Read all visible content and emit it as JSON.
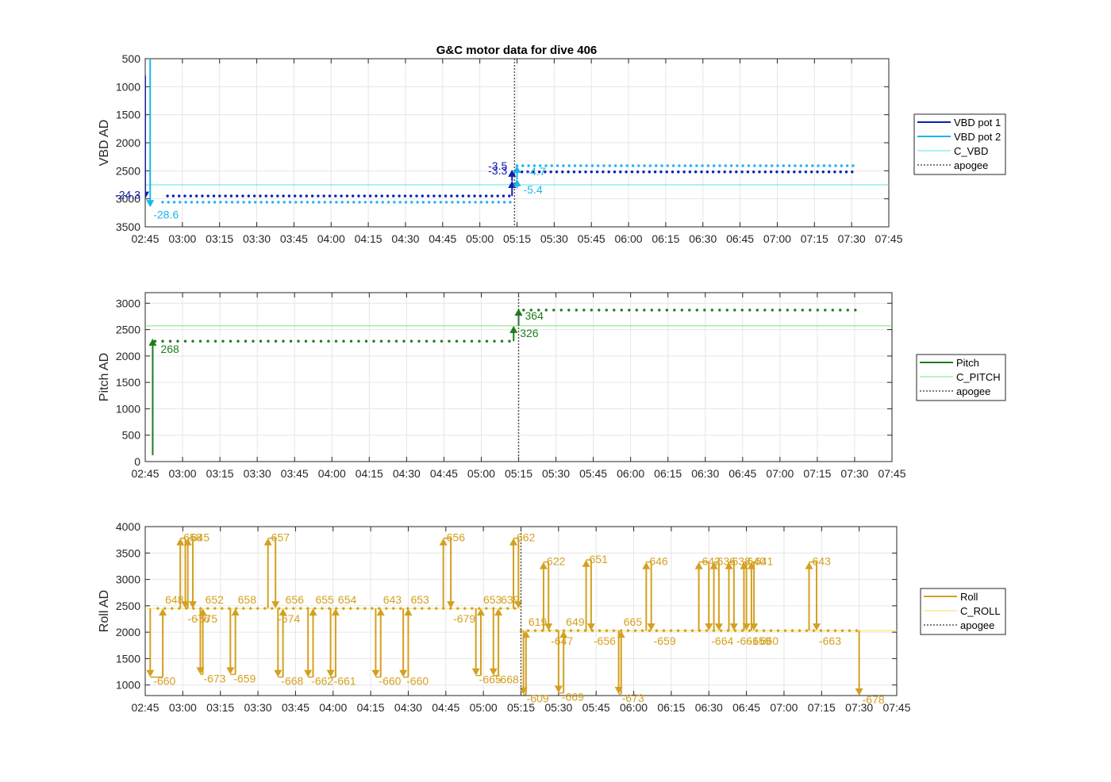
{
  "figure_title": "G&C motor data for dive 406",
  "chart_data": [
    {
      "type": "scatter",
      "id": "vbd",
      "ylabel": "VBD AD",
      "xlim": [
        "02:45",
        "07:45"
      ],
      "ylim": [
        500,
        3500
      ],
      "y_reversed": true,
      "grid": true,
      "legend_position": "right",
      "x_ticks": [
        "02:45",
        "03:00",
        "03:15",
        "03:30",
        "03:45",
        "04:00",
        "04:15",
        "04:30",
        "04:45",
        "05:00",
        "05:15",
        "05:30",
        "05:45",
        "06:00",
        "06:15",
        "06:30",
        "06:45",
        "07:00",
        "07:15",
        "07:30",
        "07:45"
      ],
      "y_ticks": [
        "500",
        "1000",
        "1500",
        "2000",
        "2500",
        "3000",
        "3500"
      ],
      "legend": [
        "VBD pot 1",
        "VBD pot 2",
        "C_VBD",
        "apogee"
      ],
      "colors": {
        "pot1": "#0d1fb4",
        "pot2": "#1ab6ee",
        "c": "#5ee0e6",
        "apogee": "#555555"
      },
      "apogee": "05:14",
      "c_level": 2750,
      "pot1_series": [
        {
          "x_start": "02:54",
          "x_end": "05:13",
          "y": 2950
        },
        {
          "x_start": "05:17",
          "x_end": "07:31",
          "y": 2520
        }
      ],
      "pot2_series": [
        {
          "x_start": "02:52",
          "x_end": "05:13",
          "y": 3060
        },
        {
          "x_start": "05:15",
          "x_end": "07:32",
          "y": 2410
        }
      ],
      "pot1_spike": {
        "x": "02:45",
        "y_from": 800,
        "y_to": 2950
      },
      "pot2_spike": {
        "x": "02:47",
        "y_from": 500,
        "y_to": 3060
      },
      "arrows": [
        {
          "x": "02:45",
          "from": 2950,
          "to": 3000,
          "label": "-24.3",
          "series": "pot1",
          "lx": -6,
          "ly": 0,
          "anchor": "end"
        },
        {
          "x": "02:47",
          "from": 3060,
          "to": 3150,
          "label": "-28.6",
          "series": "pot2",
          "lx": 4,
          "ly": 14,
          "anchor": "start"
        },
        {
          "x": "05:13",
          "from": 2950,
          "to": 2680,
          "label": "-3.3",
          "series": "pot1",
          "lx": -6,
          "ly": -8,
          "anchor": "end"
        },
        {
          "x": "05:13",
          "from": 2680,
          "to": 2480,
          "label": "-3.5",
          "series": "pot1",
          "lx": -6,
          "ly": 0,
          "anchor": "end"
        },
        {
          "x": "05:15",
          "from": 2810,
          "to": 2650,
          "label": "-5.4",
          "series": "pot2",
          "lx": 8,
          "ly": 18,
          "anchor": "start"
        },
        {
          "x": "05:15",
          "from": 2650,
          "to": 2410,
          "label": "-4.7",
          "series": "pot2",
          "lx": 12,
          "ly": 12,
          "anchor": "start"
        }
      ]
    },
    {
      "type": "scatter",
      "id": "pitch",
      "ylabel": "Pitch AD",
      "xlim": [
        "02:45",
        "07:45"
      ],
      "ylim": [
        0,
        3200
      ],
      "y_reversed": false,
      "grid": true,
      "legend_position": "right",
      "x_ticks": [
        "02:45",
        "03:00",
        "03:15",
        "03:30",
        "03:45",
        "04:00",
        "04:15",
        "04:30",
        "04:45",
        "05:00",
        "05:15",
        "05:30",
        "05:45",
        "06:00",
        "06:15",
        "06:30",
        "06:45",
        "07:00",
        "07:15",
        "07:30",
        "07:45"
      ],
      "y_ticks": [
        "0",
        "500",
        "1000",
        "1500",
        "2000",
        "2500",
        "3000"
      ],
      "legend": [
        "Pitch",
        "C_PITCH",
        "apogee"
      ],
      "colors": {
        "pitch": "#1e7d1e",
        "c": "#80e080",
        "apogee": "#555555"
      },
      "apogee": "05:15",
      "c_level": 2570,
      "series": [
        {
          "x_start": "02:49",
          "x_end": "05:13",
          "y": 2280
        },
        {
          "x_start": "05:17",
          "x_end": "07:32",
          "y": 2870
        }
      ],
      "arrows": [
        {
          "x": "02:48",
          "from": 120,
          "to": 2330,
          "label": "268",
          "lx": 10,
          "ly": 18,
          "anchor": "start"
        },
        {
          "x": "05:13",
          "from": 2280,
          "to": 2570,
          "label": "326",
          "lx": 8,
          "ly": 14,
          "anchor": "start"
        },
        {
          "x": "05:15",
          "from": 2570,
          "to": 2900,
          "label": "364",
          "lx": 8,
          "ly": 14,
          "anchor": "start"
        }
      ]
    },
    {
      "type": "scatter",
      "id": "roll",
      "ylabel": "Roll AD",
      "xlim": [
        "02:45",
        "07:45"
      ],
      "ylim": [
        800,
        4000
      ],
      "y_reversed": false,
      "grid": true,
      "legend_position": "right",
      "x_ticks": [
        "02:45",
        "03:00",
        "03:15",
        "03:30",
        "03:45",
        "04:00",
        "04:15",
        "04:30",
        "04:45",
        "05:00",
        "05:15",
        "05:30",
        "05:45",
        "06:00",
        "06:15",
        "06:30",
        "06:45",
        "07:00",
        "07:15",
        "07:30",
        "07:45"
      ],
      "y_ticks": [
        "1000",
        "1500",
        "2000",
        "2500",
        "3000",
        "3500",
        "4000"
      ],
      "legend": [
        "Roll",
        "C_ROLL",
        "apogee"
      ],
      "colors": {
        "roll": "#d4a020",
        "c": "#f5e878",
        "apogee": "#555555"
      },
      "apogee": "05:15",
      "c_levels": [
        {
          "x_start": "02:45",
          "x_end": "05:15",
          "y": 2450
        },
        {
          "x_start": "05:15",
          "x_end": "07:45",
          "y": 2030
        }
      ],
      "series": [
        {
          "x_start": "02:50",
          "x_end": "05:13",
          "y": 2450
        },
        {
          "x_start": "05:15",
          "x_end": "07:30",
          "y": 2030
        }
      ],
      "events": [
        {
          "type": "down",
          "x": "02:47",
          "base": 2450,
          "tip": 1150,
          "x2": "02:52",
          "l1": "-660",
          "l2": "648"
        },
        {
          "type": "up",
          "x": "02:59",
          "base": 2450,
          "tip": 3780,
          "x2": "03:01",
          "l1": "658",
          "l2": "-676"
        },
        {
          "type": "up",
          "x": "03:02",
          "base": 2450,
          "tip": 3780,
          "x2": "03:04",
          "l1": "645",
          "l2": "-675"
        },
        {
          "type": "down",
          "x": "03:07",
          "base": 2450,
          "tip": 1200,
          "x2": "03:08",
          "l1": "-673",
          "l2": "652"
        },
        {
          "type": "down",
          "x": "03:19",
          "base": 2450,
          "tip": 1200,
          "x2": "03:21",
          "l1": "-659",
          "l2": "658"
        },
        {
          "type": "up",
          "x": "03:34",
          "base": 2450,
          "tip": 3780,
          "x2": "03:37",
          "l1": "657",
          "l2": "-674"
        },
        {
          "type": "down",
          "x": "03:38",
          "base": 2450,
          "tip": 1150,
          "x2": "03:40",
          "l1": "-668",
          "l2": "656"
        },
        {
          "type": "down",
          "x": "03:50",
          "base": 2450,
          "tip": 1150,
          "x2": "03:52",
          "l1": "-662",
          "l2": "655"
        },
        {
          "type": "down",
          "x": "03:59",
          "base": 2450,
          "tip": 1150,
          "x2": "04:01",
          "l1": "-661",
          "l2": "654"
        },
        {
          "type": "down",
          "x": "04:17",
          "base": 2450,
          "tip": 1150,
          "x2": "04:19",
          "l1": "-660",
          "l2": "643"
        },
        {
          "type": "down",
          "x": "04:28",
          "base": 2450,
          "tip": 1150,
          "x2": "04:30",
          "l1": "-660",
          "l2": "653"
        },
        {
          "type": "up",
          "x": "04:44",
          "base": 2450,
          "tip": 3780,
          "x2": "04:47",
          "l1": "656",
          "l2": "-679"
        },
        {
          "type": "down",
          "x": "04:57",
          "base": 2450,
          "tip": 1180,
          "x2": "04:59",
          "l1": "-665",
          "l2": "653"
        },
        {
          "type": "down",
          "x": "05:04",
          "base": 2450,
          "tip": 1180,
          "x2": "05:06",
          "l1": "-668",
          "l2": "639"
        },
        {
          "type": "up",
          "x": "05:12",
          "base": 2450,
          "tip": 3780,
          "x2": "05:14",
          "l1": "662",
          "l2": ""
        },
        {
          "type": "down",
          "x": "05:16",
          "base": 2030,
          "tip": 820,
          "x2": "05:17",
          "l1": "-609",
          "l2": "619"
        },
        {
          "type": "up",
          "x": "05:24",
          "base": 2030,
          "tip": 3330,
          "x2": "05:26",
          "l1": "622",
          "l2": "-647"
        },
        {
          "type": "down",
          "x": "05:30",
          "base": 2030,
          "tip": 850,
          "x2": "05:32",
          "l1": "-669",
          "l2": "649"
        },
        {
          "type": "up",
          "x": "05:41",
          "base": 2030,
          "tip": 3370,
          "x2": "05:43",
          "l1": "651",
          "l2": "-656"
        },
        {
          "type": "down",
          "x": "05:54",
          "base": 2030,
          "tip": 830,
          "x2": "05:55",
          "l1": "-673",
          "l2": "665"
        },
        {
          "type": "up",
          "x": "06:05",
          "base": 2030,
          "tip": 3330,
          "x2": "06:07",
          "l1": "646",
          "l2": "-659"
        },
        {
          "type": "up",
          "x": "06:26",
          "base": 2030,
          "tip": 3330,
          "x2": "06:30",
          "l1": "642",
          "l2": "-664"
        },
        {
          "type": "up",
          "x": "06:32",
          "base": 2030,
          "tip": 3330,
          "x2": "06:34",
          "l1": "636",
          "l2": ""
        },
        {
          "type": "up",
          "x": "06:38",
          "base": 2030,
          "tip": 3330,
          "x2": "06:40",
          "l1": "638",
          "l2": "-661"
        },
        {
          "type": "up",
          "x": "06:44",
          "base": 2030,
          "tip": 3330,
          "x2": "06:45",
          "l1": "640",
          "l2": "-659"
        },
        {
          "type": "up",
          "x": "06:47",
          "base": 2030,
          "tip": 3330,
          "x2": "06:48",
          "l1": "641",
          "l2": "-660"
        },
        {
          "type": "up",
          "x": "07:10",
          "base": 2030,
          "tip": 3330,
          "x2": "07:13",
          "l1": "643",
          "l2": "-663"
        },
        {
          "type": "down",
          "x": "07:30",
          "base": 2030,
          "tip": 800,
          "x2": "",
          "l1": "-678",
          "l2": ""
        }
      ]
    }
  ]
}
